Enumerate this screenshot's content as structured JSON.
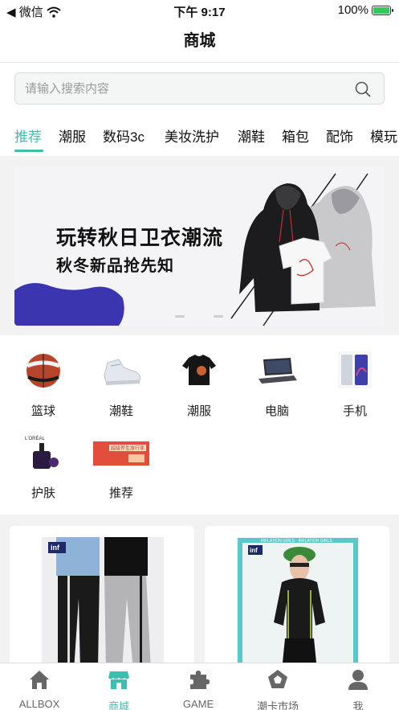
{
  "status_bar": {
    "back_app": "◀ 微信",
    "time": "下午 9:17",
    "battery": "100%"
  },
  "header": {
    "title": "商城"
  },
  "search": {
    "placeholder": "请输入搜索内容",
    "value": ""
  },
  "tabs": [
    {
      "label": "推荐",
      "active": true
    },
    {
      "label": "潮服"
    },
    {
      "label": "数码3c"
    },
    {
      "label": "美妆洗护"
    },
    {
      "label": "潮鞋"
    },
    {
      "label": "箱包"
    },
    {
      "label": "配饰"
    },
    {
      "label": "模玩"
    }
  ],
  "banner": {
    "line1": "玩转秋日卫衣潮流",
    "line2": "秋冬新品抢先知",
    "slide_index": 1,
    "slide_count": 2
  },
  "categories": [
    {
      "label": "篮球",
      "icon": "basketball-icon"
    },
    {
      "label": "潮鞋",
      "icon": "sneaker-icon"
    },
    {
      "label": "潮服",
      "icon": "tshirt-icon"
    },
    {
      "label": "电脑",
      "icon": "laptop-icon"
    },
    {
      "label": "手机",
      "icon": "phone-icon"
    },
    {
      "label": "护肤",
      "icon": "skincare-bottle-icon",
      "brand": "L'ORÉAL"
    },
    {
      "label": "推荐",
      "icon": "recommend-banner-icon",
      "badge": "超级养生旅行季"
    }
  ],
  "products": [
    {
      "brand": "inf LATION"
    },
    {
      "brand": "inf LATION",
      "frame_text": "INFLATION GIRLS"
    }
  ],
  "bottom_nav": [
    {
      "label": "ALLBOX",
      "icon": "home-icon"
    },
    {
      "label": "商城",
      "icon": "store-icon",
      "active": true
    },
    {
      "label": "GAME",
      "icon": "puzzle-icon"
    },
    {
      "label": "潮卡市场",
      "icon": "pentagon-icon"
    },
    {
      "label": "我",
      "icon": "user-icon"
    }
  ],
  "colors": {
    "accent": "#3dbfb0",
    "banner_blob": "#3b36b0",
    "gray_icon": "#666666"
  }
}
